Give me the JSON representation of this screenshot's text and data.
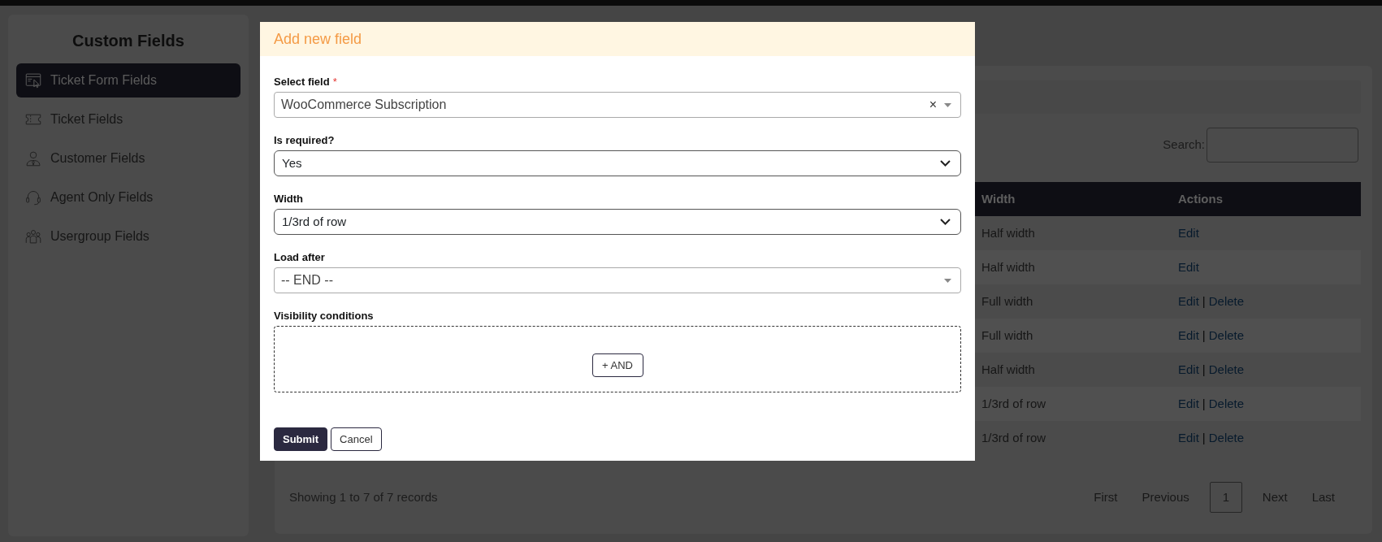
{
  "sidebar": {
    "title": "Custom Fields",
    "items": [
      {
        "label": "Ticket Form Fields",
        "selected": true
      },
      {
        "label": "Ticket Fields",
        "selected": false
      },
      {
        "label": "Customer Fields",
        "selected": false
      },
      {
        "label": "Agent Only Fields",
        "selected": false
      },
      {
        "label": "Usergroup Fields",
        "selected": false
      }
    ]
  },
  "content": {
    "search": {
      "label": "Search:"
    },
    "table": {
      "columns": [
        "Width",
        "Actions"
      ],
      "rows": [
        {
          "width": "Half width",
          "actions": [
            {
              "kind": "link",
              "text": "Edit"
            }
          ]
        },
        {
          "width": "Half width",
          "actions": [
            {
              "kind": "link",
              "text": "Edit"
            }
          ]
        },
        {
          "width": "Full width",
          "actions": [
            {
              "kind": "link",
              "text": "Edit"
            },
            {
              "kind": "separator",
              "text": "|"
            },
            {
              "kind": "link",
              "text": "Delete"
            }
          ]
        },
        {
          "width": "Full width",
          "actions": [
            {
              "kind": "link",
              "text": "Edit"
            },
            {
              "kind": "separator",
              "text": "|"
            },
            {
              "kind": "link",
              "text": "Delete"
            }
          ]
        },
        {
          "width": "Half width",
          "actions": [
            {
              "kind": "link",
              "text": "Edit"
            },
            {
              "kind": "separator",
              "text": "|"
            },
            {
              "kind": "link",
              "text": "Delete"
            }
          ]
        },
        {
          "width": "1/3rd of row",
          "actions": [
            {
              "kind": "link",
              "text": "Edit"
            },
            {
              "kind": "separator",
              "text": "|"
            },
            {
              "kind": "link",
              "text": "Delete"
            }
          ]
        },
        {
          "width": "1/3rd of row",
          "actions": [
            {
              "kind": "link",
              "text": "Edit"
            },
            {
              "kind": "separator",
              "text": "|"
            },
            {
              "kind": "link",
              "text": "Delete"
            }
          ]
        }
      ]
    },
    "summary": "Showing 1 to 7 of 7 records",
    "pagination": [
      {
        "label": "First",
        "selected": false
      },
      {
        "label": "Previous",
        "selected": false
      },
      {
        "label": "1",
        "selected": true
      },
      {
        "label": "Next",
        "selected": false
      },
      {
        "label": "Last",
        "selected": false
      }
    ]
  },
  "modal": {
    "title": "Add new field",
    "fields": [
      {
        "kind": "select2",
        "label": "Select field",
        "required_mark": "*",
        "value": "WooCommerce Subscription",
        "clear": "×"
      },
      {
        "kind": "select",
        "label": "Is required?",
        "value": "Yes"
      },
      {
        "kind": "select",
        "label": "Width",
        "value": "1/3rd of row"
      },
      {
        "kind": "select2",
        "label": "Load after",
        "value": "-- END --"
      },
      {
        "kind": "conditions",
        "label": "Visibility conditions",
        "button": "+ AND"
      }
    ],
    "buttons": [
      {
        "kind": "primary",
        "label": "Submit"
      },
      {
        "kind": "secondary",
        "label": "Cancel"
      }
    ]
  }
}
